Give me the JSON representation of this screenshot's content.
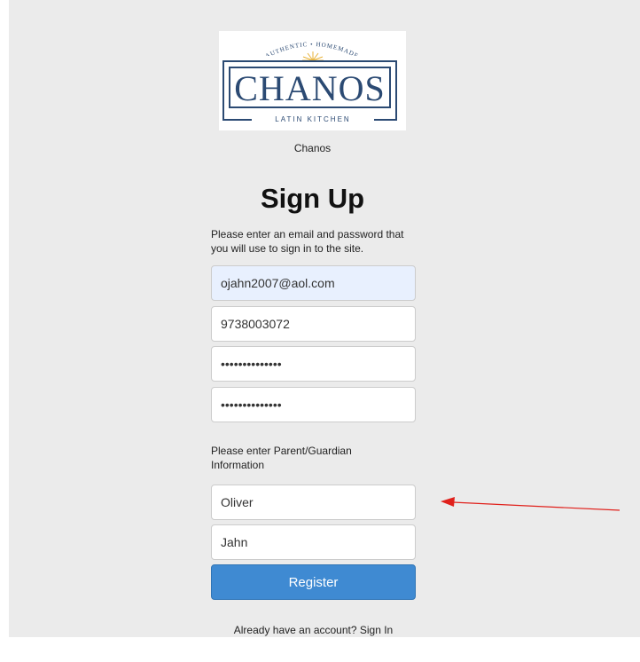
{
  "logo": {
    "arc_text": "AUTHENTIC • HOMEMADE",
    "wordmark": "CHANOS",
    "tagline": "LATIN KITCHEN"
  },
  "restaurant_name": "Chanos",
  "signup": {
    "title": "Sign Up",
    "instructions": "Please enter an email and password that you will use to sign in to the site.",
    "email_value": "ojahn2007@aol.com",
    "phone_value": "9738003072",
    "password_value": "••••••••••••••",
    "confirm_password_value": "••••••••••••••",
    "parent_instructions": "Please enter Parent/Guardian Information",
    "parent_first_name_value": "Oliver",
    "parent_last_name_value": "Jahn",
    "register_label": "Register",
    "signin_text": "Already have an account? Sign In"
  },
  "colors": {
    "panel_background": "#ebebeb",
    "brand_navy": "#2b4a73",
    "button_blue": "#3f8ad2",
    "autofill_blue": "#e8f0fe",
    "annotation_arrow": "#e0201b"
  }
}
